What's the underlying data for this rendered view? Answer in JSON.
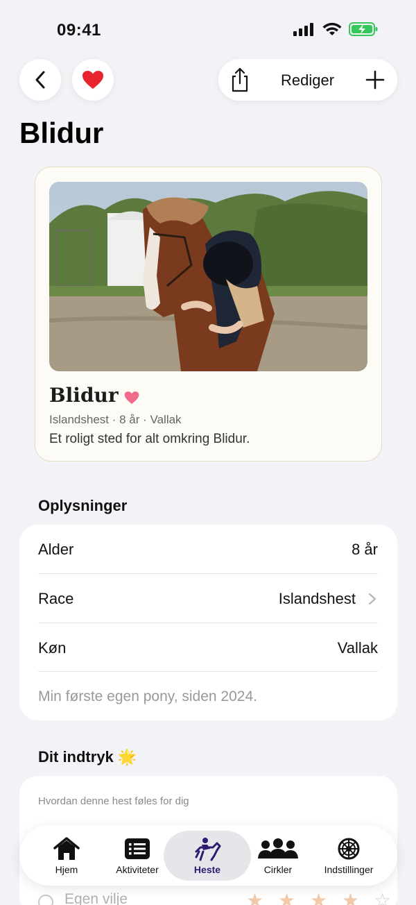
{
  "status_bar": {
    "time": "09:41"
  },
  "nav": {
    "edit_label": "Rediger"
  },
  "page": {
    "title": "Blidur"
  },
  "horse_card": {
    "name": "Blidur",
    "meta": "Islandshest · 8 år · Vallak",
    "description": "Et roligt sted for alt omkring Blidur."
  },
  "info": {
    "section_title": "Oplysninger",
    "rows": [
      {
        "label": "Alder",
        "value": "8 år"
      },
      {
        "label": "Race",
        "value": "Islandshest"
      },
      {
        "label": "Køn",
        "value": "Vallak"
      }
    ],
    "note": "Min første egen pony, siden 2024."
  },
  "impression": {
    "section_title": "Dit indtryk 🌟",
    "hint": "Hvordan denne hest føles for dig",
    "rows": [
      {
        "label": "Egen vilje",
        "rating": 4,
        "max": 5
      }
    ]
  },
  "tabs": [
    {
      "label": "Hjem",
      "icon": "house-icon"
    },
    {
      "label": "Aktiviteter",
      "icon": "list-icon"
    },
    {
      "label": "Heste",
      "icon": "horse-rider-icon",
      "active": true
    },
    {
      "label": "Cirkler",
      "icon": "people-icon"
    },
    {
      "label": "Indstillinger",
      "icon": "settings-wheel-icon"
    }
  ],
  "colors": {
    "accent": "#2d1b72",
    "heart": "#e8252f",
    "card_heart": "#f06a8a",
    "star": "#f2c9a9"
  }
}
